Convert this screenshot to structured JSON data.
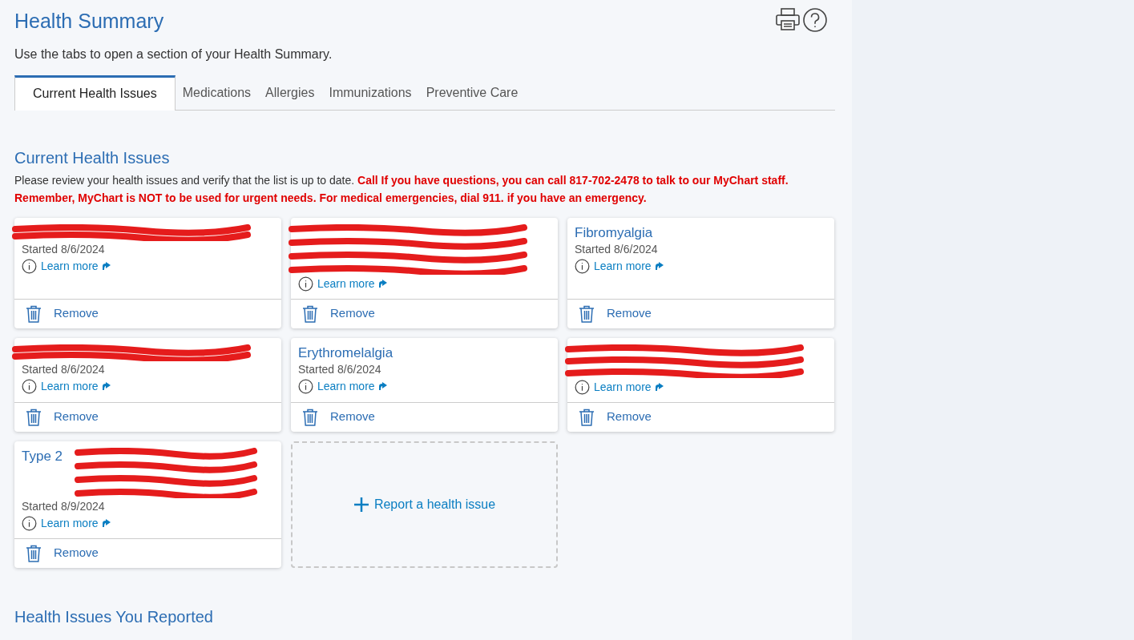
{
  "page": {
    "title": "Health Summary",
    "intro": "Use the tabs to open a section of your Health Summary."
  },
  "tabs": [
    {
      "label": "Current Health Issues",
      "selected": true
    },
    {
      "label": "Medications",
      "selected": false
    },
    {
      "label": "Allergies",
      "selected": false
    },
    {
      "label": "Immunizations",
      "selected": false
    },
    {
      "label": "Preventive Care",
      "selected": false
    }
  ],
  "section": {
    "heading": "Current Health Issues",
    "notice": "Please review your health issues and verify that the list is up to date. **Call If you have questions, you can call 817-702-2478 to talk to our MyChart staff. Remember, MyChart is NOT to be used for urgent needs. For medical emergencies, dial 911. if you have an emergency.**"
  },
  "issues": [
    {
      "started": "Started 8/6/2024",
      "kind": "masked",
      "link": "Learn more",
      "action": "Remove"
    },
    {
      "kind": "blotted",
      "link": "Learn more",
      "action": "Remove"
    },
    {
      "title": "Fibromyalgia",
      "started": "Started 8/6/2024",
      "kind": "plain",
      "link": "Learn more",
      "action": "Remove"
    },
    {
      "started": "Started 8/6/2024",
      "kind": "masked",
      "link": "Learn more",
      "action": "Remove"
    },
    {
      "title": "Erythromelalgia",
      "started": "Started 8/6/2024",
      "kind": "plain",
      "link": "Learn more",
      "action": "Remove"
    },
    {
      "kind": "doublemasked",
      "link": "Learn more",
      "action": "Remove"
    },
    {
      "title": "Type 2",
      "started": "Started 8/9/2024",
      "kind": "blotted",
      "link": "Learn more",
      "action": "Remove"
    }
  ],
  "add_button": "Report a health issue",
  "next_heading": "Health Issues You Reported"
}
